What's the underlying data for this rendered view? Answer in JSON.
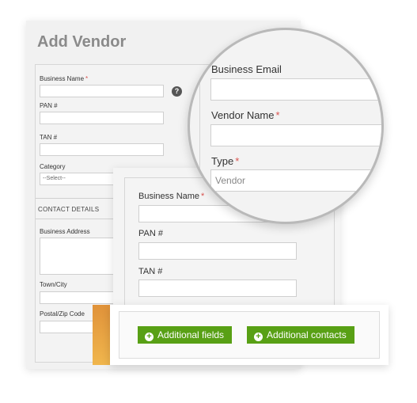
{
  "page": {
    "title": "Add Vendor"
  },
  "base_form": {
    "business_name_label": "Business Name",
    "required_mark": "*",
    "help_icon": "?",
    "pan_label": "PAN #",
    "tan_label": "TAN #",
    "category_label": "Category",
    "category_value": "--Select--",
    "contact_details_heading": "CONTACT DETAILS",
    "business_address_label": "Business Address",
    "town_city_label": "Town/City",
    "postal_zip_label": "Postal/Zip Code"
  },
  "mid_form": {
    "business_name_label": "Business Name",
    "required_mark": "*",
    "pan_label": "PAN #",
    "tan_label": "TAN #"
  },
  "magnified": {
    "business_email_label": "Business Email",
    "vendor_name_label": "Vendor Name",
    "type_label": "Type",
    "required_mark": "*",
    "type_value": "Vendor"
  },
  "actions": {
    "additional_fields_label": "Additional fields",
    "additional_contacts_label": "Additional contacts",
    "plus_icon": "+"
  },
  "colors": {
    "accent_green": "#58a015",
    "required_red": "#d9534f",
    "orange_tab": "#e0923a"
  }
}
